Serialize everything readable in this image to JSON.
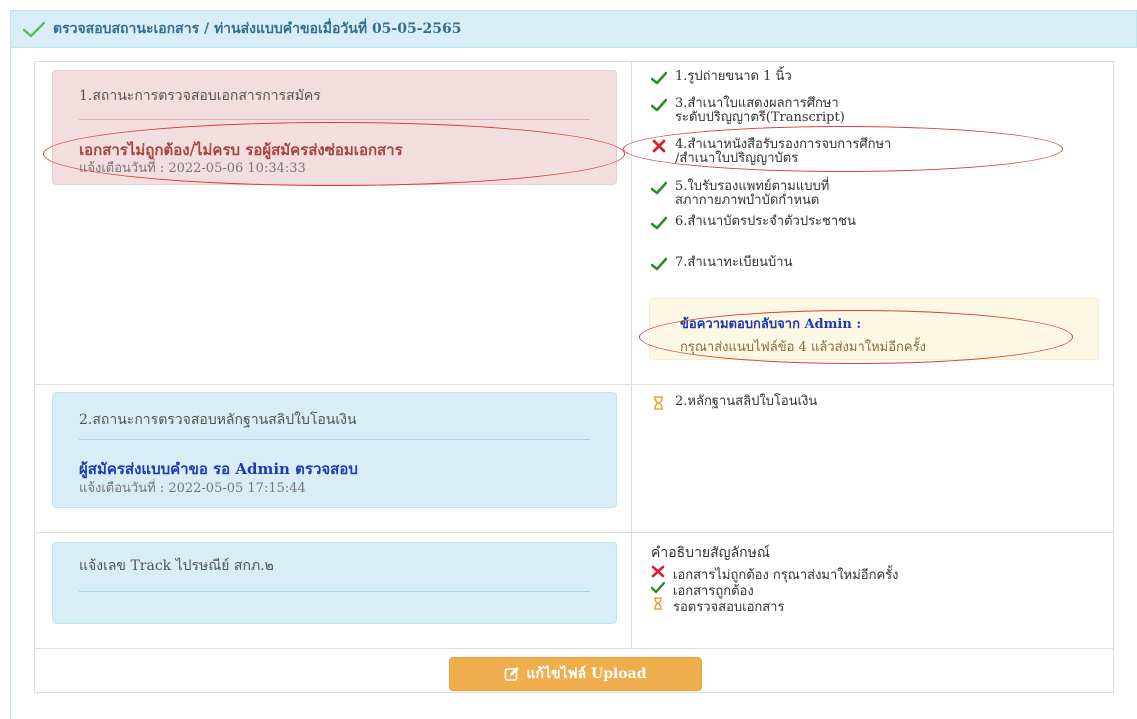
{
  "header": {
    "title": "ตรวจสอบสถานะเอกสาร / ท่านส่งแบบคำขอเมื่อวันที่ 05-05-2565"
  },
  "document_status": {
    "title": "1.สถานะการตรวจสอบเอกสารการสมัคร",
    "status_text": "เอกสารไม่ถูกต้อง/ไม่ครบ รอผู้สมัครส่งซ่อมเอกสาร",
    "notify_label": "แจ้งเตือนวันที่ : 2022-05-06 10:34:33"
  },
  "documents": [
    {
      "status": "ok",
      "text": "1.รูปถ่ายขนาด 1 นิ้ว"
    },
    {
      "status": "ok",
      "text": "3.สำเนาใบแสดงผลการศึกษา",
      "text2": "ระดับปริญญาตรี(Transcript)"
    },
    {
      "status": "error",
      "text": "4.สำเนาหนังสือรับรองการจบการศึกษา",
      "text2": "/สำเนาใบปริญญาบัตร"
    },
    {
      "status": "ok",
      "text": "5.ใบรับรองแพทย์ตามแบบที่",
      "text2": "สภากายภาพบำบัดกำหนด"
    },
    {
      "status": "ok",
      "text": "6.สำเนาบัตรประจำตัวประชาชน"
    },
    {
      "status": "ok",
      "text": "7.สำเนาทะเบียนบ้าน"
    }
  ],
  "admin_message": {
    "title": "ข้อความตอบกลับจาก Admin :",
    "body": "กรุณาส่งแนบไฟล์ข้อ 4 แล้วส่งมาใหม่อีกครั้ง"
  },
  "payment_status": {
    "title": "2.สถานะการตรวจสอบหลักฐานสลิปใบโอนเงิน",
    "status_text": "ผู้สมัครส่งแบบคำขอ รอ Admin ตรวจสอบ",
    "notify_label": "แจ้งเตือนวันที่ : 2022-05-05 17:15:44"
  },
  "payment_item": {
    "status": "pending",
    "text": "2.หลักฐานสลิปใบโอนเงิน"
  },
  "tracking": {
    "title": "แจ้งเลข Track ไปรษณีย์ สกภ.๒"
  },
  "legend": {
    "title": "คำอธิบายสัญลักษณ์",
    "items": [
      {
        "icon": "cross-icon",
        "text": "เอกสารไม่ถูกต้อง กรุณาส่งมาใหม่อีกครั้ง"
      },
      {
        "icon": "check-icon",
        "text": "เอกสารถูกต้อง"
      },
      {
        "icon": "hourglass-icon",
        "text": "รอตรวจสอบเอกสาร"
      }
    ]
  },
  "upload_button": {
    "label": "แก้ไขไฟล์ Upload"
  },
  "colors": {
    "check": "#2e8b2e",
    "cross": "#d9202e",
    "hourglass": "#e8a53a",
    "annotation": "#e03b3b"
  }
}
